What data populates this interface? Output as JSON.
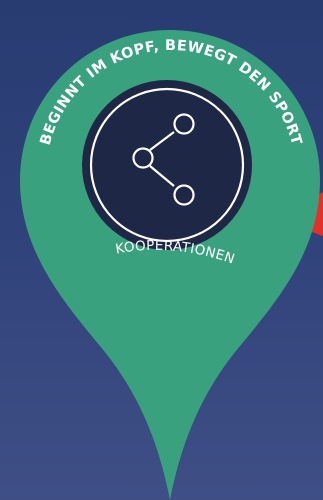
{
  "badge": {
    "arc_text": "BEGINNT IM KOPF, BEWEGT DEN SPORT",
    "label": "KOOPERATIONEN",
    "icon": "share-icon"
  },
  "colors": {
    "background_top": "#283c72",
    "background_bottom": "#3f4f86",
    "pin": "#3aa17f",
    "pin_shadow": "#2d8a6b",
    "inner_disc": "#1f2746",
    "ring": "#ffffff",
    "accent_red": "#e2302b",
    "text": "#ffffff"
  }
}
